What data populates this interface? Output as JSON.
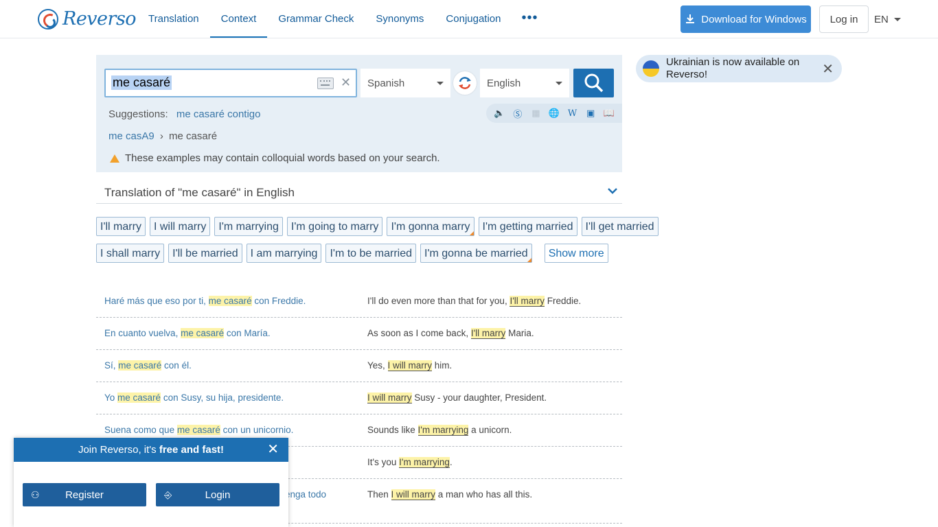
{
  "header": {
    "logo_text": "Reverso",
    "nav": [
      "Translation",
      "Context",
      "Grammar Check",
      "Synonyms",
      "Conjugation"
    ],
    "nav_more": "•••",
    "download_label": "Download for Windows",
    "login_label": "Log in",
    "language": "EN"
  },
  "search": {
    "query": "me casaré",
    "source_lang": "Spanish",
    "target_lang": "English",
    "suggestions_label": "Suggestions:",
    "suggestion": "me casaré contigo",
    "crumb_1": "me casA9",
    "crumb_sep": "›",
    "crumb_2": "me casaré",
    "warning": "These examples may contain colloquial words based on your search."
  },
  "translation_title": "Translation of \"me casaré\" in English",
  "chips_row1": [
    "I'll marry",
    "I will marry",
    "I'm marrying",
    "I'm going to marry",
    "I'm gonna marry",
    "I'm getting married",
    "I'll get married"
  ],
  "chips_row2": [
    "I shall marry",
    "I'll be married",
    "I am marrying",
    "I'm to be married",
    "I'm gonna be married"
  ],
  "show_more": "Show more",
  "examples": [
    {
      "src_pre": "Haré más que eso por ti, ",
      "src_hl": "me casaré",
      "src_post": " con Freddie.",
      "tgt_pre": "I'll do even more than that for you, ",
      "tgt_hl": "I'll marry",
      "tgt_post": " Freddie."
    },
    {
      "src_pre": "En cuanto vuelva, ",
      "src_hl": "me casaré",
      "src_post": " con María.",
      "tgt_pre": "As soon as I come back, ",
      "tgt_hl": "I'll marry",
      "tgt_post": " Maria."
    },
    {
      "src_pre": "Sí, ",
      "src_hl": "me casaré",
      "src_post": " con él.",
      "tgt_pre": "Yes, ",
      "tgt_hl": "I will marry",
      "tgt_post": " him."
    },
    {
      "src_pre": "Yo ",
      "src_hl": "me casaré",
      "src_post": " con Susy, su hija, presidente.",
      "tgt_pre": "",
      "tgt_hl": "I will marry",
      "tgt_post": " Susy - your daughter, President."
    },
    {
      "src_pre": "Suena como que ",
      "src_hl": "me casaré",
      "src_post": " con un unicornio.",
      "tgt_pre": "Sounds like ",
      "tgt_hl": "I'm marrying",
      "tgt_post": " a unicorn."
    },
    {
      "src_pre": "",
      "src_hl": "",
      "src_post": "",
      "tgt_pre": "It's you ",
      "tgt_hl": "I'm marrying",
      "tgt_post": "."
    },
    {
      "src_pre": "",
      "src_hl": "",
      "src_post": "enga todo",
      "tgt_pre": "Then ",
      "tgt_hl": "I will marry",
      "tgt_post": " a man who has all this."
    }
  ],
  "promo": {
    "text": "Ukrainian is now available on Reverso!"
  },
  "join": {
    "title_pre": "Join Reverso, it's ",
    "title_bold": "free and fast!",
    "register": "Register",
    "login": "Login"
  }
}
